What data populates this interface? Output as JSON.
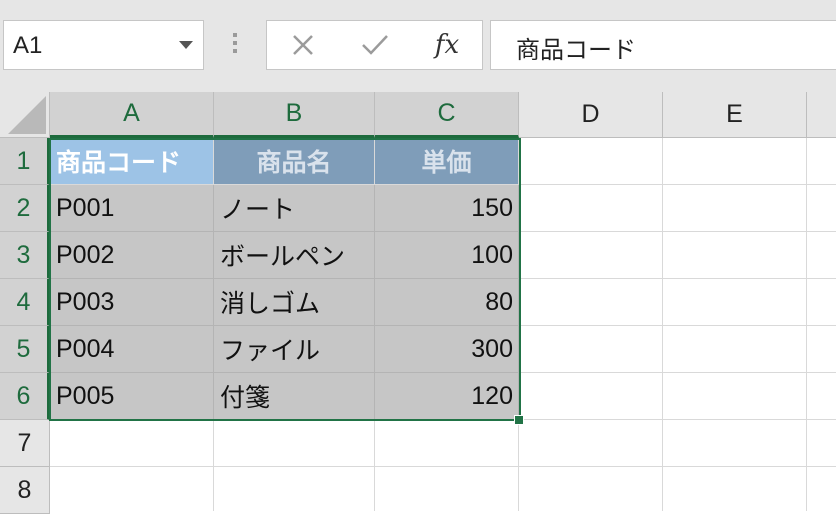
{
  "formula_bar": {
    "name_box": "A1",
    "cancel_symbol": "✕",
    "enter_symbol": "✓",
    "fx_label": "fx",
    "formula_value": "商品コード"
  },
  "columns": [
    "A",
    "B",
    "C",
    "D",
    "E"
  ],
  "rows": [
    "1",
    "2",
    "3",
    "4",
    "5",
    "6",
    "7",
    "8"
  ],
  "table": {
    "headers": [
      "商品コード",
      "商品名",
      "単価"
    ],
    "rows": [
      [
        "P001",
        "ノート",
        "150"
      ],
      [
        "P002",
        "ボールペン",
        "100"
      ],
      [
        "P003",
        "消しゴム",
        "80"
      ],
      [
        "P004",
        "ファイル",
        "300"
      ],
      [
        "P005",
        "付箋",
        "120"
      ]
    ]
  },
  "colors": {
    "selection_border": "#217346",
    "header_a_fill": "#9DC3E6",
    "header_bc_fill": "#7F9DB9",
    "selected_fill": "#C6C6C6"
  }
}
